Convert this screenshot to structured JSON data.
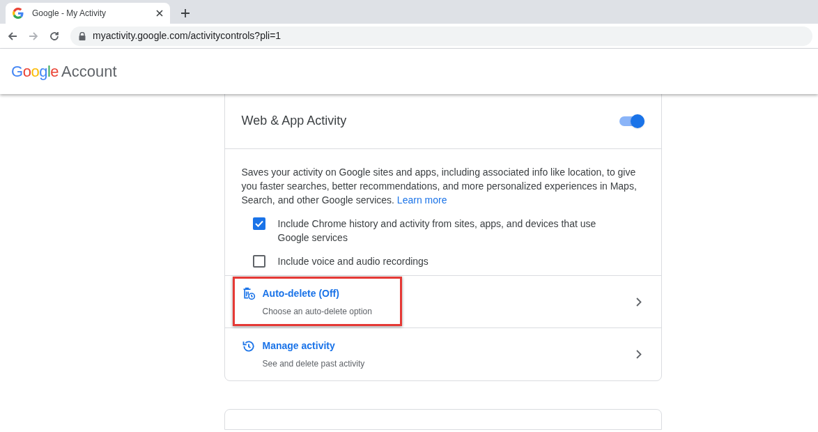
{
  "browser": {
    "tab": {
      "title": "Google - My Activity",
      "selected": true
    },
    "url": "myactivity.google.com/activitycontrols?pli=1"
  },
  "header": {
    "logo": "Google",
    "product": "Account"
  },
  "card": {
    "title": "Web & App Activity",
    "toggle_on": true,
    "description": "Saves your activity on Google sites and apps, including associated info like location, to give you faster searches, better recommendations, and more personalized experiences in Maps, Search, and other Google services.",
    "learn_more": "Learn more",
    "options": [
      {
        "label": "Include Chrome history and activity from sites, apps, and devices that use Google services",
        "checked": true
      },
      {
        "label": "Include voice and audio recordings",
        "checked": false
      }
    ],
    "links": [
      {
        "kind": "auto-delete",
        "title": "Auto-delete (Off)",
        "subtitle": "Choose an auto-delete option",
        "highlighted": true
      },
      {
        "kind": "history",
        "title": "Manage activity",
        "subtitle": "See and delete past activity",
        "highlighted": false
      }
    ]
  }
}
